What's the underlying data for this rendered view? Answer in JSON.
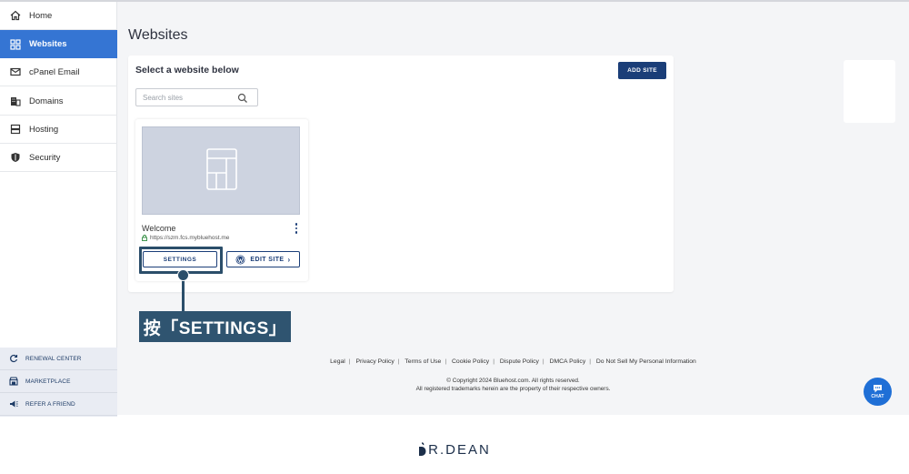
{
  "sidebar": {
    "items": [
      {
        "label": "Home",
        "icon": "home-icon",
        "active": false
      },
      {
        "label": "Websites",
        "icon": "websites-icon",
        "active": true
      },
      {
        "label": "cPanel Email",
        "icon": "email-icon",
        "active": false
      },
      {
        "label": "Domains",
        "icon": "domains-icon",
        "active": false
      },
      {
        "label": "Hosting",
        "icon": "hosting-icon",
        "active": false
      },
      {
        "label": "Security",
        "icon": "security-icon",
        "active": false
      }
    ],
    "utility": [
      {
        "label": "RENEWAL CENTER",
        "icon": "renewal-icon"
      },
      {
        "label": "MARKETPLACE",
        "icon": "marketplace-icon"
      },
      {
        "label": "REFER A FRIEND",
        "icon": "megaphone-icon"
      }
    ]
  },
  "main": {
    "title": "Websites",
    "panel_header": "Select a website below",
    "add_site_label": "ADD SITE",
    "search_placeholder": "Search sites",
    "site": {
      "name": "Welcome",
      "url": "https://szm.fcs.mybluehost.me",
      "settings_label": "SETTINGS",
      "edit_label": "EDIT SITE"
    }
  },
  "annotation": {
    "label": "按「SETTINGS」"
  },
  "footer": {
    "links": [
      "Legal",
      "Privacy Policy",
      "Terms of Use",
      "Cookie Policy",
      "Dispute Policy",
      "DMCA Policy",
      "Do Not Sell My Personal Information"
    ],
    "copyright": "© Copyright 2024 Bluehost.com. All rights reserved.",
    "trademark": "All registered trademarks herein are the property of their respective owners.",
    "chat_label": "CHAT"
  },
  "brand": {
    "text": "R.DEAN"
  },
  "colors": {
    "accent": "#3575d3",
    "navy": "#1b3e78",
    "annotation": "#2f5470",
    "chat": "#1f6fd6"
  }
}
